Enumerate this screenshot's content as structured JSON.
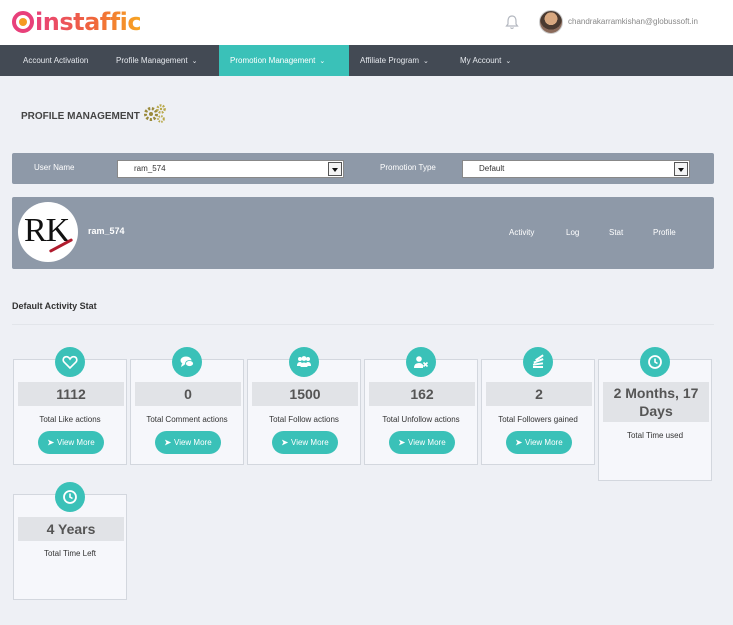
{
  "header": {
    "logo_text": "instaffic",
    "user_email": "chandrakarramkishan@globussoft.in"
  },
  "nav": {
    "items": [
      {
        "label": "Account Activation"
      },
      {
        "label": "Profile Management"
      },
      {
        "label": "Promotion Management"
      },
      {
        "label": "Affiliate Program"
      },
      {
        "label": "My Account"
      }
    ],
    "active": "Promotion Management",
    "accent_color": "#3ac1b8"
  },
  "page": {
    "title": "PROFILE MANAGEMENT"
  },
  "filters": {
    "username_label": "User Name",
    "username_value": "ram_574",
    "promotion_label": "Promotion Type",
    "promotion_value": "Default"
  },
  "profile": {
    "avatar_text": "RK",
    "name": "ram_574",
    "tabs": [
      "Activity",
      "Log",
      "Stat",
      "Profile"
    ]
  },
  "section": {
    "title": "Default Activity Stat"
  },
  "stats": [
    {
      "icon": "heart-icon",
      "value": "1112",
      "label": "Total Like actions",
      "button": "View More"
    },
    {
      "icon": "comment-icon",
      "value": "0",
      "label": "Total Comment actions",
      "button": "View More"
    },
    {
      "icon": "users-icon",
      "value": "1500",
      "label": "Total Follow actions",
      "button": "View More"
    },
    {
      "icon": "user-remove-icon",
      "value": "162",
      "label": "Total Unfollow actions",
      "button": "View More"
    },
    {
      "icon": "stack-icon",
      "value": "2",
      "label": "Total Followers gained",
      "button": "View More"
    },
    {
      "icon": "clock-icon",
      "value": "2 Months, 17 Days",
      "label": "Total Time used"
    },
    {
      "icon": "clock-icon",
      "value": "4 Years",
      "label": "Total Time Left"
    }
  ]
}
